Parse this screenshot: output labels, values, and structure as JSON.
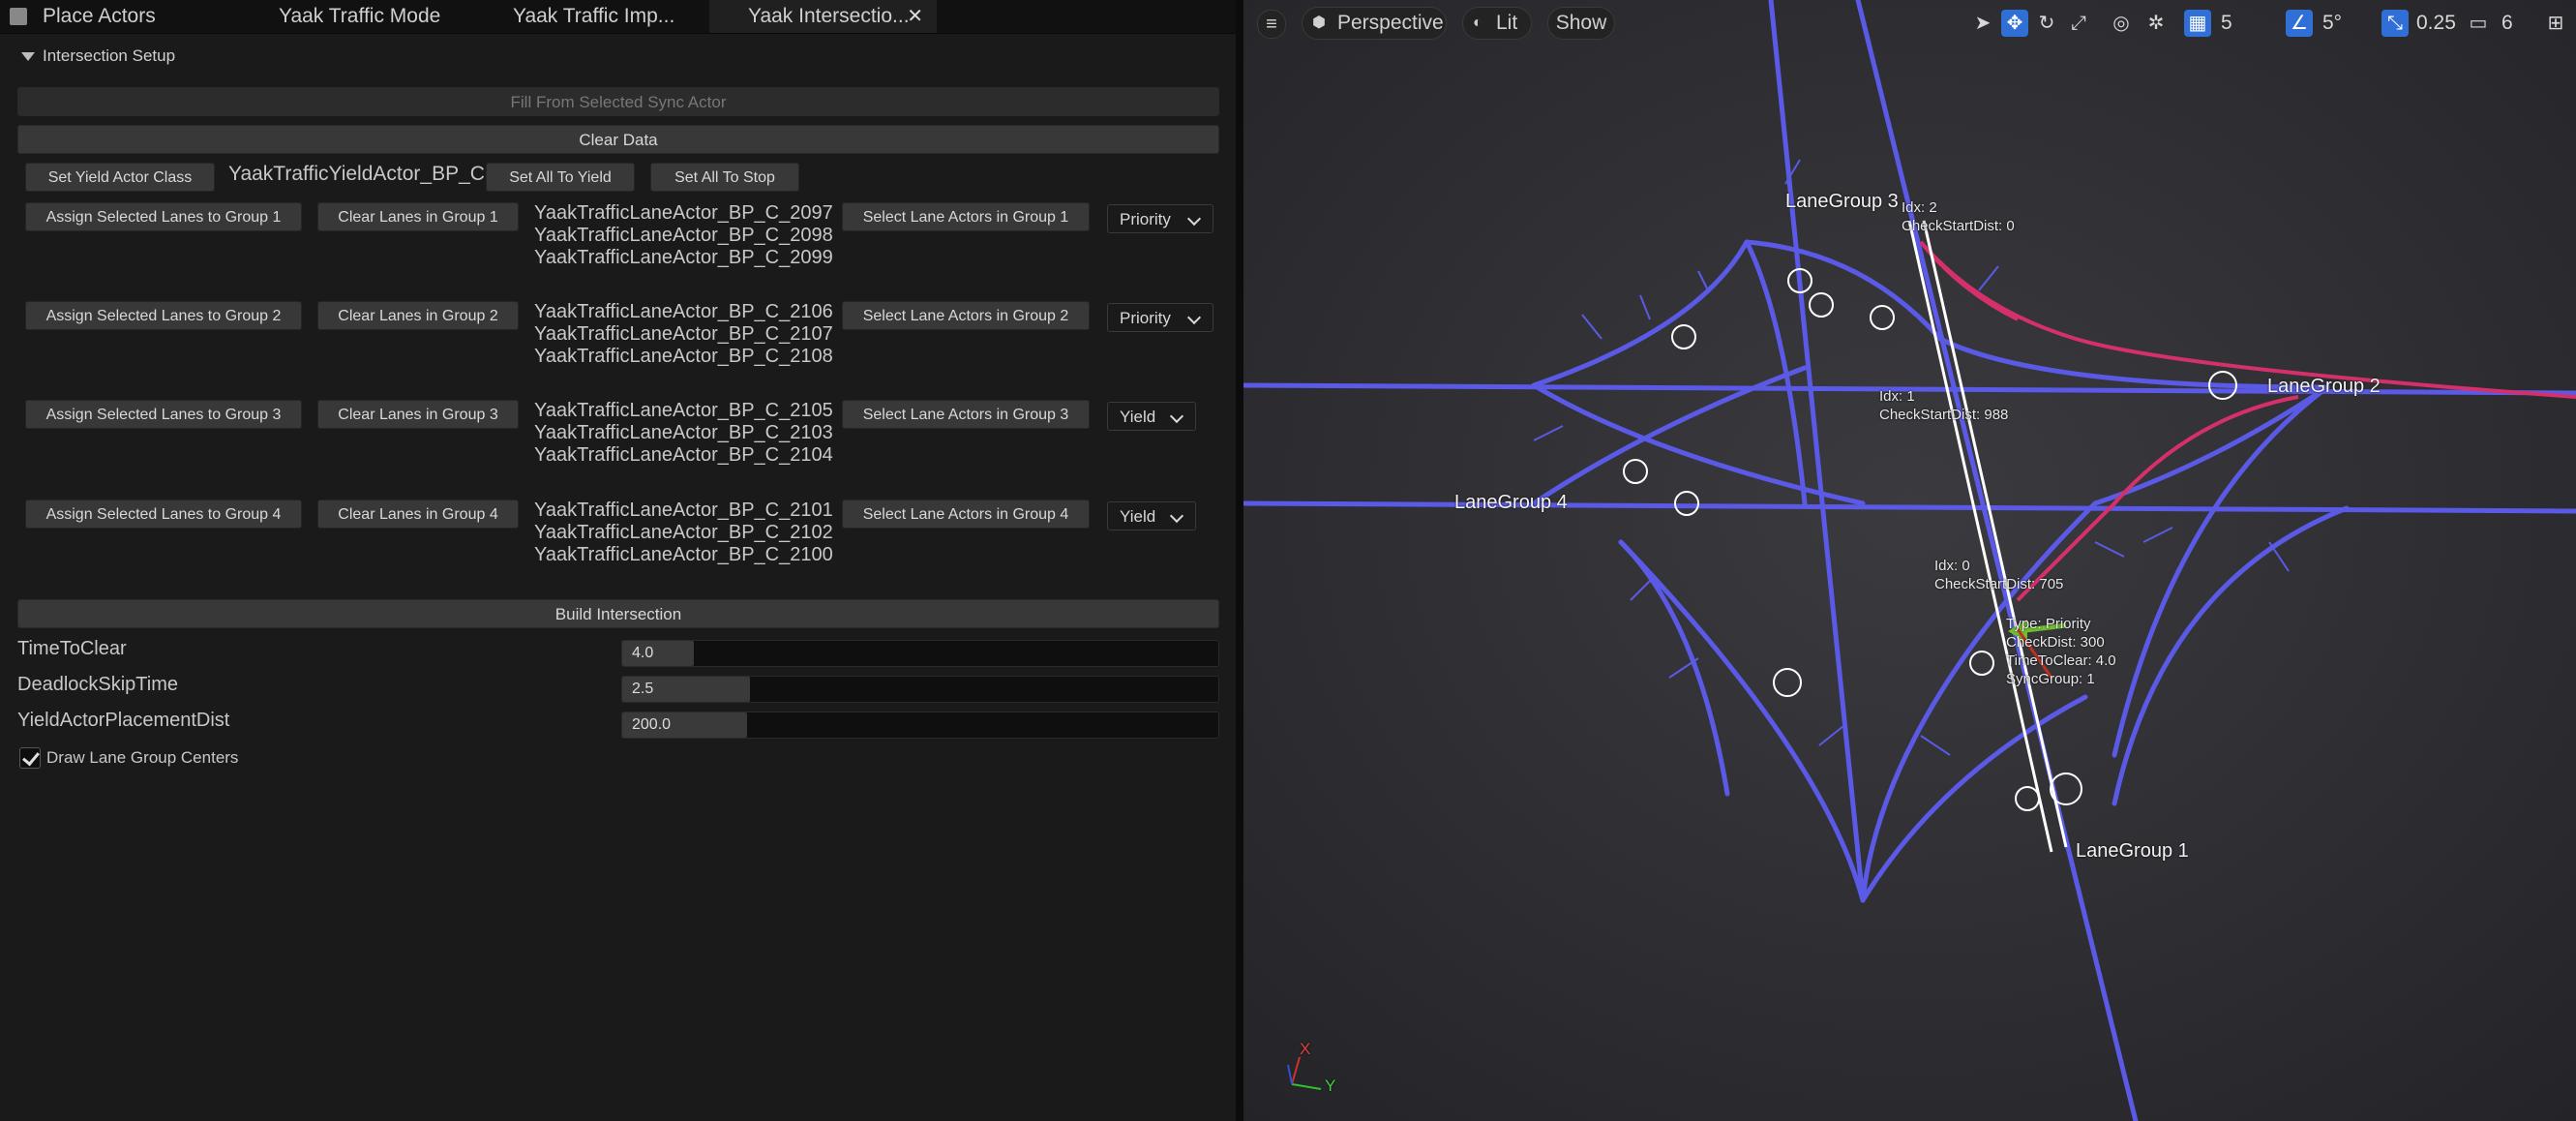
{
  "tabs": [
    {
      "label": "Place Actors",
      "icon": "place-actors-icon"
    },
    {
      "label": "Yaak Traffic Mode"
    },
    {
      "label": "Yaak Traffic Imp..."
    },
    {
      "label": "Yaak Intersectio...",
      "close": "✕"
    }
  ],
  "section": {
    "title": "Intersection Setup"
  },
  "buttons": {
    "fill_from_sync": "Fill From Selected Sync Actor",
    "clear_data": "Clear Data",
    "set_yield_actor_class": "Set Yield Actor Class",
    "yield_actor_class_value": "YaakTrafficYieldActor_BP_C",
    "set_all_to_yield": "Set All To Yield",
    "set_all_to_stop": "Set All To Stop",
    "build_intersection": "Build Intersection"
  },
  "groups": [
    {
      "assign": "Assign Selected Lanes to Group 1",
      "clear": "Clear Lanes in Group 1",
      "lanes": [
        "YaakTrafficLaneActor_BP_C_2097",
        "YaakTrafficLaneActor_BP_C_2098",
        "YaakTrafficLaneActor_BP_C_2099"
      ],
      "select": "Select Lane Actors in Group 1",
      "type": "Priority"
    },
    {
      "assign": "Assign Selected Lanes to Group 2",
      "clear": "Clear Lanes in Group 2",
      "lanes": [
        "YaakTrafficLaneActor_BP_C_2106",
        "YaakTrafficLaneActor_BP_C_2107",
        "YaakTrafficLaneActor_BP_C_2108"
      ],
      "select": "Select Lane Actors in Group 2",
      "type": "Priority"
    },
    {
      "assign": "Assign Selected Lanes to Group 3",
      "clear": "Clear Lanes in Group 3",
      "lanes": [
        "YaakTrafficLaneActor_BP_C_2105",
        "YaakTrafficLaneActor_BP_C_2103",
        "YaakTrafficLaneActor_BP_C_2104"
      ],
      "select": "Select Lane Actors in Group 3",
      "type": "Yield"
    },
    {
      "assign": "Assign Selected Lanes to Group 4",
      "clear": "Clear Lanes in Group 4",
      "lanes": [
        "YaakTrafficLaneActor_BP_C_2101",
        "YaakTrafficLaneActor_BP_C_2102",
        "YaakTrafficLaneActor_BP_C_2100"
      ],
      "select": "Select Lane Actors in Group 4",
      "type": "Yield"
    }
  ],
  "properties": [
    {
      "name": "TimeToClear",
      "value": "4.0",
      "fill_fraction": 0.12
    },
    {
      "name": "DeadlockSkipTime",
      "value": "2.5",
      "fill_fraction": 0.215
    },
    {
      "name": "YieldActorPlacementDist",
      "value": "200.0",
      "fill_fraction": 0.21
    }
  ],
  "checkbox": {
    "label": "Draw Lane Group Centers",
    "checked": true
  },
  "viewport": {
    "perspective": "Perspective",
    "lit": "Lit",
    "show": "Show",
    "grid_value": "5",
    "angle_value": "5°",
    "scale_value": "0.25",
    "camera_value": "6",
    "labels": {
      "lane_group_1": "LaneGroup 1",
      "lane_group_2": "LaneGroup 2",
      "lane_group_3": "LaneGroup 3",
      "lane_group_4": "LaneGroup 4"
    },
    "annotations": {
      "idx2": "Idx: 2\nCheckStartDist: 0",
      "idx1": "Idx: 1\nCheckStartDist: 988",
      "idx0": "Idx: 0\nCheckStartDist: 705",
      "sync": "Type: Priority\nCheckDist: 300\nTimeToClear: 4.0\nSyncGroup: 1"
    },
    "axis": {
      "x": "X",
      "y": "Y"
    },
    "colors": {
      "lane_blue": "#5a5ae6",
      "highlight_red": "#d6306a",
      "accent_blue": "#2f6fd6"
    }
  }
}
